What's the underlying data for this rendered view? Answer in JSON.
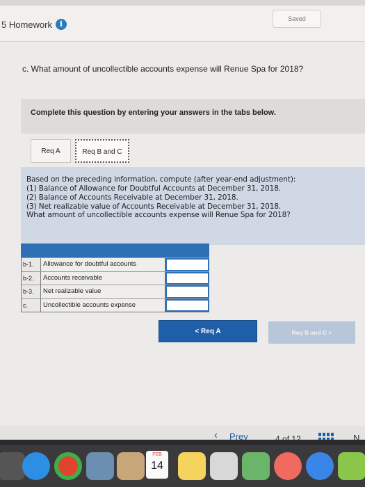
{
  "header": {
    "assignment_title": "5 Homework",
    "info_icon": "i",
    "saved_label": "Saved"
  },
  "question": {
    "text": "c. What amount of uncollectible accounts expense will Renue Spa for 2018?"
  },
  "instructions": "Complete this question by entering your answers in the tabs below.",
  "tabs": [
    {
      "label": "Req A",
      "active": false
    },
    {
      "label": "Req B and C",
      "active": true
    }
  ],
  "prompt_lines": [
    "Based on the preceding information, compute (after year-end adjustment):",
    "(1) Balance of Allowance for Doubtful Accounts at December 31, 2018.",
    "(2) Balance of Accounts Receivable at December 31, 2018.",
    "(3) Net realizable value of Accounts Receivable at December 31, 2018.",
    "What amount of uncollectible accounts expense will Renue Spa for 2018?"
  ],
  "answer_table": {
    "rows": [
      {
        "code": "b-1.",
        "label": "Allowance for doubtful accounts",
        "value": ""
      },
      {
        "code": "b-2.",
        "label": "Accounts receivable",
        "value": ""
      },
      {
        "code": "b-3.",
        "label": "Net realizable value",
        "value": ""
      },
      {
        "code": "c.",
        "label": "Uncollectible accounts expense",
        "value": ""
      }
    ]
  },
  "nav_buttons": {
    "prev_tab": "< Req A",
    "next_tab": "Req B and C >"
  },
  "pager": {
    "prev": "Prev",
    "current": "4",
    "of": "of",
    "total": "12",
    "next": "N"
  },
  "dock": {
    "calendar_month": "FEB",
    "calendar_day": "14"
  }
}
